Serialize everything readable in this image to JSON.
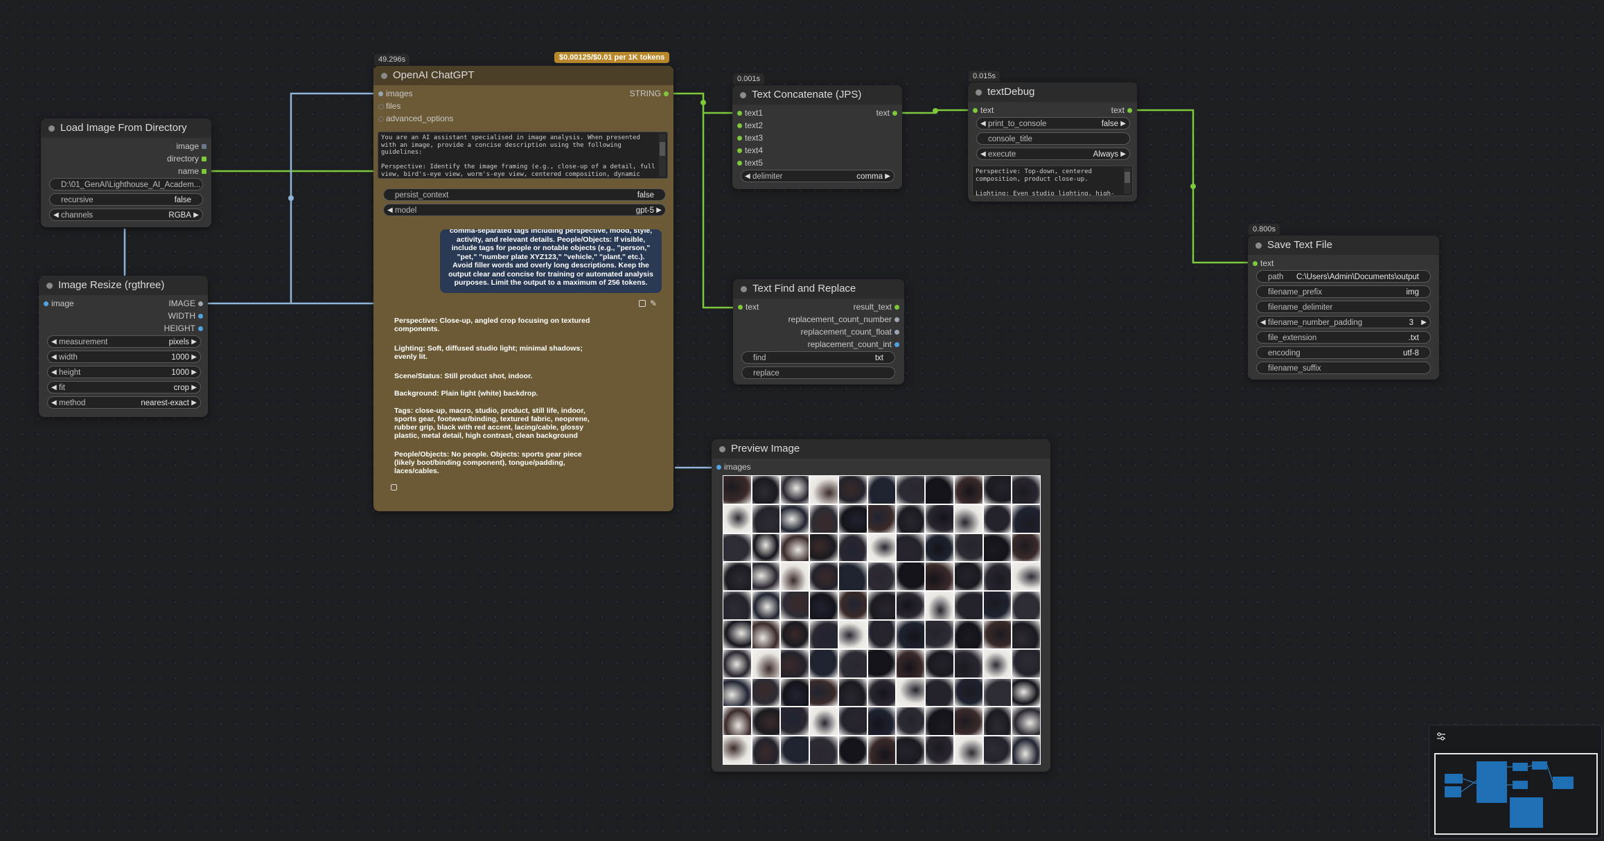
{
  "colors": {
    "accent_green": "#7ec93b",
    "wire_blue": "#8fb6d8",
    "node_brown": "#6b5a35",
    "cost_badge": "#b9882a"
  },
  "load_image": {
    "title": "Load Image From Directory",
    "outputs": [
      "image",
      "directory",
      "name"
    ],
    "widgets": [
      {
        "label": "D:\\01_GenAI\\Lighthouse_AI_Academ..."
      },
      {
        "label": "recursive",
        "value": "false"
      },
      {
        "label": "channels",
        "value": "RGBA"
      }
    ]
  },
  "resize": {
    "title": "Image Resize (rgthree)",
    "input": "image",
    "outputs": [
      "IMAGE",
      "WIDTH",
      "HEIGHT"
    ],
    "widgets": [
      {
        "label": "measurement",
        "value": "pixels"
      },
      {
        "label": "width",
        "value": "1000"
      },
      {
        "label": "height",
        "value": "1000"
      },
      {
        "label": "fit",
        "value": "crop"
      },
      {
        "label": "method",
        "value": "nearest-exact"
      }
    ]
  },
  "chatgpt": {
    "title": "OpenAI ChatGPT",
    "timing": "49.296s",
    "cost": "$0.00125/$0.01 per 1K tokens",
    "inputs": [
      "images",
      "files",
      "advanced_options"
    ],
    "output": "STRING",
    "prompt": "You are an AI assistant specialised in image analysis. When presented with an image, provide a concise description using the following guidelines:\n\nPerspective: Identify the image framing (e.g., close-up of a detail, full view, bird's-eye view, worm's-eye view, centered composition, dynamic tilted shot).",
    "widgets": [
      {
        "label": "persist_context",
        "value": "false"
      },
      {
        "label": "model",
        "value": "gpt-5"
      }
    ],
    "bubble": "comma-separated tags including perspective, mood, style, activity, and relevant details. People/Objects: If visible, include tags for people or notable objects (e.g., \"person,\" \"pet,\" \"number plate XYZ123,\" \"vehicle,\" \"plant,\" etc.). Avoid filler words and overly long descriptions. Keep the output clear and concise for training or automated analysis purposes. Limit the output to a maximum of 256 tokens.",
    "reply": [
      "Perspective: Close-up, angled crop focusing on textured components.",
      "Lighting: Soft, diffused studio light; minimal shadows; evenly lit.",
      "Scene/Status: Still product shot, indoor.",
      "Background: Plain light (white) backdrop.",
      "Tags: close-up, macro, studio, product, still life, indoor, sports gear, footwear/binding, textured fabric, neoprene, rubber grip, black with red accent, lacing/cable, glossy plastic, metal detail, high contrast, clean background",
      "People/Objects: No people. Objects: sports gear piece (likely boot/binding component), tongue/padding, laces/cables."
    ]
  },
  "concat": {
    "title": "Text Concatenate (JPS)",
    "timing": "0.001s",
    "inputs": [
      "text1",
      "text2",
      "text3",
      "text4",
      "text5"
    ],
    "output": "text",
    "widget": {
      "label": "delimiter",
      "value": "comma"
    }
  },
  "debug": {
    "title": "textDebug",
    "timing": "0.015s",
    "input": "text",
    "output": "text",
    "widgets": [
      {
        "label": "print_to_console",
        "value": "false"
      },
      {
        "label": "console_title"
      },
      {
        "label": "execute",
        "value": "Always"
      }
    ],
    "preview": "Perspective: Top-down, centered composition, product close-up.\n\nLighting: Even studio lighting, high-"
  },
  "findreplace": {
    "title": "Text Find and Replace",
    "input": "text",
    "outputs": [
      "result_text",
      "replacement_count_number",
      "replacement_count_float",
      "replacement_count_int"
    ],
    "widgets": [
      {
        "label": "find",
        "value": "txt"
      },
      {
        "label": "replace"
      }
    ]
  },
  "save": {
    "title": "Save Text File",
    "timing": "0.800s",
    "input": "text",
    "widgets": [
      {
        "label": "path",
        "value": "C:\\Users\\Admin\\Documents\\output"
      },
      {
        "label": "filename_prefix",
        "value": "img"
      },
      {
        "label": "filename_delimiter"
      },
      {
        "label": "filename_number_padding",
        "value": "3"
      },
      {
        "label": "file_extension",
        "value": ".txt"
      },
      {
        "label": "encoding",
        "value": "utf-8"
      },
      {
        "label": "filename_suffix"
      }
    ]
  },
  "preview": {
    "title": "Preview Image",
    "input": "images"
  },
  "minimap": {
    "settings_icon": "sliders-icon"
  }
}
